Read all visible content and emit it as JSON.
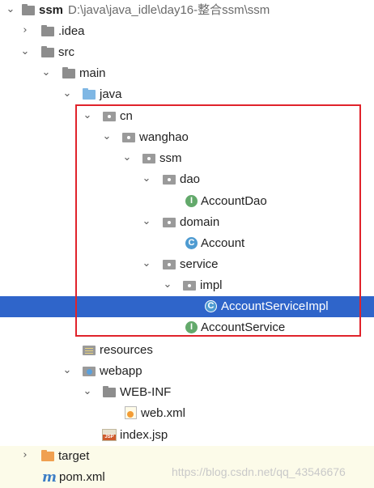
{
  "tree": {
    "project": {
      "name": "ssm",
      "path": "D:\\java\\java_idle\\day16-整合ssm\\ssm"
    },
    "idea": ".idea",
    "src": "src",
    "main": "main",
    "java": "java",
    "cn": "cn",
    "wanghao": "wanghao",
    "ssm": "ssm",
    "dao": "dao",
    "account_dao": "AccountDao",
    "domain": "domain",
    "account": "Account",
    "service": "service",
    "impl": "impl",
    "account_service_impl": "AccountServiceImpl",
    "account_service": "AccountService",
    "resources": "resources",
    "webapp": "webapp",
    "web_inf": "WEB-INF",
    "web_xml": "web.xml",
    "index_jsp": "index.jsp",
    "target": "target",
    "pom_xml": "pom.xml"
  },
  "icons": {
    "interface_letter": "I",
    "class_letter": "C",
    "jsp_tag": "JSP",
    "maven_letter": "m"
  },
  "watermark": "https://blog.csdn.net/qq_43546676",
  "colors": {
    "selection": "#2f65ca",
    "highlight_box": "#e0232b",
    "interface_icon": "#63a96b",
    "class_icon": "#4e9bd1"
  }
}
